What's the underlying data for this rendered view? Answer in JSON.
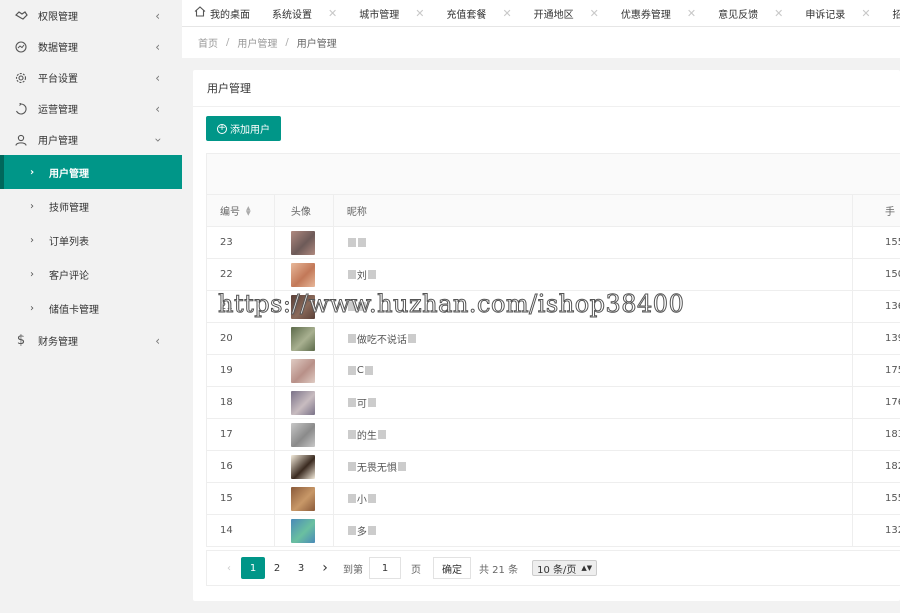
{
  "sidebar": {
    "items": [
      {
        "label": "权限管理",
        "icon": "handshake-icon"
      },
      {
        "label": "数据管理",
        "icon": "chart-circle-icon"
      },
      {
        "label": "平台设置",
        "icon": "gear-icon"
      },
      {
        "label": "运营管理",
        "icon": "cycle-icon"
      },
      {
        "label": "用户管理",
        "icon": "user-icon"
      },
      {
        "label": "财务管理",
        "icon": "dollar-icon"
      }
    ],
    "sub_items": [
      "用户管理",
      "技师管理",
      "订单列表",
      "客户评论",
      "储值卡管理"
    ]
  },
  "tabs": [
    "我的桌面",
    "系统设置",
    "城市管理",
    "充值套餐",
    "开通地区",
    "优惠券管理",
    "意见反馈",
    "申诉记录",
    "招"
  ],
  "breadcrumb": [
    "首页",
    "用户管理",
    "用户管理"
  ],
  "card": {
    "title": "用户管理",
    "add_button": "添加用户"
  },
  "table": {
    "headers": {
      "id": "编号",
      "avatar": "头像",
      "nickname": "昵称",
      "phone": "手"
    },
    "rows": [
      {
        "id": "23",
        "nick": "",
        "phone": "155",
        "c1": "#b08a80",
        "c2": "#6d5a58"
      },
      {
        "id": "22",
        "nick": "刘",
        "phone": "150",
        "c1": "#e8b89a",
        "c2": "#c27858"
      },
      {
        "id": "21",
        "nick": "",
        "phone": "136",
        "c1": "#5a4038",
        "c2": "#8a6a5a"
      },
      {
        "id": "20",
        "nick": "做吃不说话",
        "phone": "139",
        "c1": "#5c6a4a",
        "c2": "#a8b090"
      },
      {
        "id": "19",
        "nick": "C",
        "phone": "175",
        "c1": "#e0ccc4",
        "c2": "#b89088"
      },
      {
        "id": "18",
        "nick": "可",
        "phone": "176",
        "c1": "#7a7288",
        "c2": "#c8bcc0"
      },
      {
        "id": "17",
        "nick": "的生",
        "phone": "183",
        "c1": "#c8c8c8",
        "c2": "#8a8a8a"
      },
      {
        "id": "16",
        "nick": "无畏无惧",
        "phone": "182",
        "c1": "#f4ecdc",
        "c2": "#3a2a20"
      },
      {
        "id": "15",
        "nick": "小",
        "phone": "155",
        "c1": "#8a5a3a",
        "c2": "#c89868"
      },
      {
        "id": "14",
        "nick": "多",
        "phone": "132",
        "c1": "#4a8ab8",
        "c2": "#6ac0a0"
      }
    ]
  },
  "pager": {
    "prev": "‹",
    "pages": [
      "1",
      "2",
      "3"
    ],
    "next": "›",
    "goto_label": "到第",
    "goto_value": "1",
    "page_unit": "页",
    "confirm": "确定",
    "total": "共 21 条",
    "per_page": "10 条/页"
  },
  "watermark": "https://www.huzhan.com/ishop38400",
  "colors": {
    "accent": "#009688",
    "accent_dark": "#00675b"
  }
}
